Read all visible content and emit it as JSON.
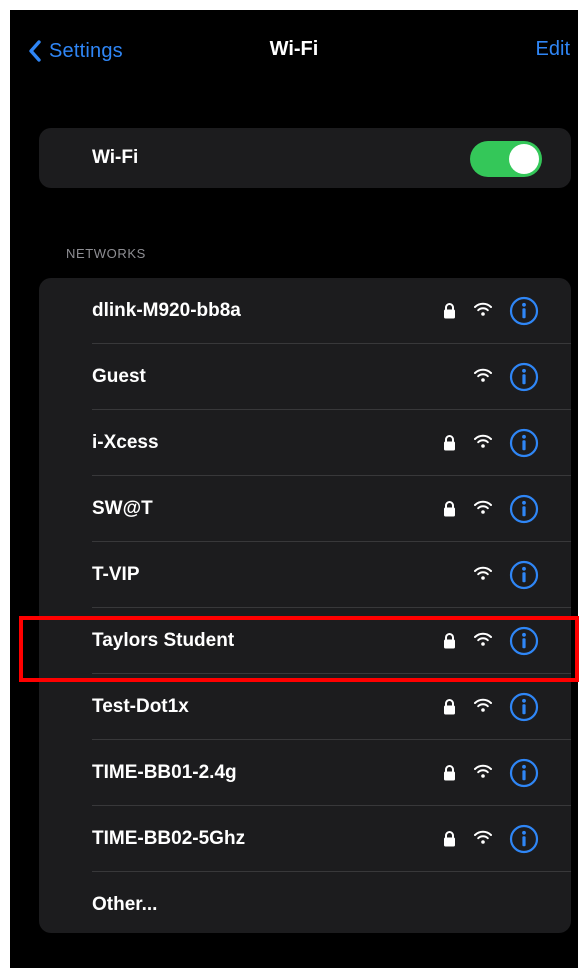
{
  "nav": {
    "back_label": "Settings",
    "title": "Wi-Fi",
    "edit_label": "Edit"
  },
  "wifi_toggle": {
    "label": "Wi-Fi",
    "on": true
  },
  "networks_section": {
    "header": "NETWORKS"
  },
  "networks": [
    {
      "name": "dlink-M920-bb8a",
      "locked": true
    },
    {
      "name": "Guest",
      "locked": false
    },
    {
      "name": "i-Xcess",
      "locked": true
    },
    {
      "name": "SW@T",
      "locked": true
    },
    {
      "name": "T-VIP",
      "locked": false
    },
    {
      "name": "Taylors Student",
      "locked": true,
      "highlighted": true
    },
    {
      "name": "Test-Dot1x",
      "locked": true
    },
    {
      "name": "TIME-BB01-2.4g",
      "locked": true
    },
    {
      "name": "TIME-BB02-5Ghz",
      "locked": true
    }
  ],
  "other": {
    "label": "Other..."
  },
  "colors": {
    "accent": "#2f86f6",
    "toggle_on": "#34c759",
    "highlight_box": "#ff0000"
  },
  "icons": {
    "back": "chevron-left-icon",
    "lock": "lock-icon",
    "signal": "wifi-signal-icon",
    "info": "info-circle-icon"
  }
}
